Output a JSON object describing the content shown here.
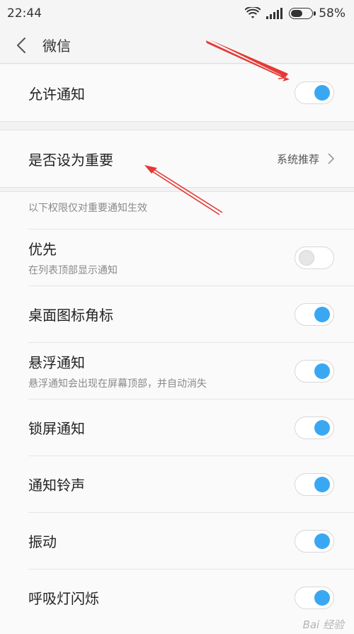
{
  "status_bar": {
    "time": "22:44",
    "battery_percent": "58%",
    "battery_level": 0.58
  },
  "app_bar": {
    "title": "微信"
  },
  "allow_notifications": {
    "label": "允许通知",
    "on": true
  },
  "important": {
    "label": "是否设为重要",
    "value": "系统推荐"
  },
  "section": {
    "header": "以下权限仅对重要通知生效",
    "items": [
      {
        "label": "优先",
        "sub": "在列表顶部显示通知",
        "on": false
      },
      {
        "label": "桌面图标角标",
        "sub": "",
        "on": true
      },
      {
        "label": "悬浮通知",
        "sub": "悬浮通知会出现在屏幕顶部，并自动消失",
        "on": true
      },
      {
        "label": "锁屏通知",
        "sub": "",
        "on": true
      },
      {
        "label": "通知铃声",
        "sub": "",
        "on": true
      },
      {
        "label": "振动",
        "sub": "",
        "on": true
      },
      {
        "label": "呼吸灯闪烁",
        "sub": "",
        "on": true
      }
    ]
  },
  "watermark": "Bai 经验",
  "colors": {
    "accent": "#3aa7f3",
    "annotation": "#e53935"
  },
  "icons": [
    "wifi-icon",
    "signal-icon",
    "battery-icon",
    "back-arrow-icon",
    "chevron-right-icon"
  ]
}
